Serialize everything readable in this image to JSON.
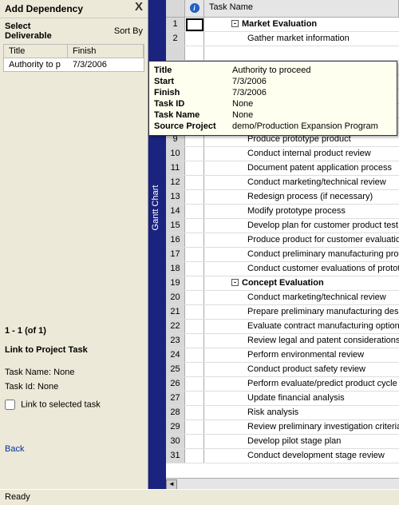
{
  "sidebar": {
    "title": "Add Dependency",
    "close_label": "X",
    "select_label": "Select Deliverable",
    "sortby_label": "Sort By",
    "col_title": "Title",
    "col_finish": "Finish",
    "row_title": "Authority to p",
    "row_finish": "7/3/2006",
    "pager": "1 - 1 (of 1)",
    "link_title": "Link to Project Task",
    "taskname_label": "Task Name:",
    "taskname_value": "None",
    "taskid_label": "Task Id:",
    "taskid_value": "None",
    "link_chk_label": "Link to selected task",
    "back_label": "Back"
  },
  "tooltip": {
    "title_label": "Title",
    "title_value": "Authority to proceed",
    "start_label": "Start",
    "start_value": "7/3/2006",
    "finish_label": "Finish",
    "finish_value": "7/3/2006",
    "taskid_label": "Task ID",
    "taskid_value": "None",
    "taskname_label": "Task Name",
    "taskname_value": "None",
    "source_label": "Source Project",
    "source_value": "demo/Production Expansion Program"
  },
  "grid": {
    "gantt_label": "Gantt Chart",
    "info_icon": "i",
    "taskname_header": "Task Name",
    "toggle_glyph": "-",
    "left_arrow": "◄"
  },
  "tasks": [
    {
      "num": "1",
      "name": "Market Evaluation",
      "summary": true,
      "indent": 0
    },
    {
      "num": "2",
      "name": "Gather market information",
      "summary": false,
      "indent": 1
    },
    {
      "num": "",
      "name": "",
      "summary": false,
      "indent": 1
    },
    {
      "num": "",
      "name": "",
      "summary": false,
      "indent": 1
    },
    {
      "num": "",
      "name": "",
      "summary": false,
      "indent": 1
    },
    {
      "num": "",
      "name": "",
      "summary": false,
      "indent": 1
    },
    {
      "num": "",
      "name": "",
      "summary": false,
      "indent": 1
    },
    {
      "num": "",
      "name": "",
      "summary": false,
      "indent": 1
    },
    {
      "num": "9",
      "name": "Produce prototype product",
      "summary": false,
      "indent": 1
    },
    {
      "num": "10",
      "name": "Conduct internal product review",
      "summary": false,
      "indent": 1
    },
    {
      "num": "11",
      "name": "Document patent application process",
      "summary": false,
      "indent": 1
    },
    {
      "num": "12",
      "name": "Conduct marketing/technical review",
      "summary": false,
      "indent": 1
    },
    {
      "num": "13",
      "name": "Redesign process (if necessary)",
      "summary": false,
      "indent": 1
    },
    {
      "num": "14",
      "name": "Modify prototype process",
      "summary": false,
      "indent": 1
    },
    {
      "num": "15",
      "name": "Develop plan for customer product test",
      "summary": false,
      "indent": 1
    },
    {
      "num": "16",
      "name": "Produce product for customer evaluation",
      "summary": false,
      "indent": 1
    },
    {
      "num": "17",
      "name": "Conduct preliminary manufacturing process",
      "summary": false,
      "indent": 1
    },
    {
      "num": "18",
      "name": "Conduct customer evaluations of prototype",
      "summary": false,
      "indent": 1
    },
    {
      "num": "19",
      "name": "Concept Evaluation",
      "summary": true,
      "indent": 0
    },
    {
      "num": "20",
      "name": "Conduct marketing/technical review",
      "summary": false,
      "indent": 1
    },
    {
      "num": "21",
      "name": "Prepare preliminary manufacturing design",
      "summary": false,
      "indent": 1
    },
    {
      "num": "22",
      "name": "Evaluate contract manufacturing option",
      "summary": false,
      "indent": 1
    },
    {
      "num": "23",
      "name": "Review legal and patent considerations",
      "summary": false,
      "indent": 1
    },
    {
      "num": "24",
      "name": "Perform environmental review",
      "summary": false,
      "indent": 1
    },
    {
      "num": "25",
      "name": "Conduct product safety review",
      "summary": false,
      "indent": 1
    },
    {
      "num": "26",
      "name": "Perform evaluate/predict product cycle",
      "summary": false,
      "indent": 1
    },
    {
      "num": "27",
      "name": "Update financial analysis",
      "summary": false,
      "indent": 1
    },
    {
      "num": "28",
      "name": "Risk analysis",
      "summary": false,
      "indent": 1
    },
    {
      "num": "29",
      "name": "Review preliminary investigation criteria",
      "summary": false,
      "indent": 1
    },
    {
      "num": "30",
      "name": "Develop pilot stage plan",
      "summary": false,
      "indent": 1
    },
    {
      "num": "31",
      "name": "Conduct development stage review",
      "summary": false,
      "indent": 1
    }
  ],
  "status": {
    "text": "Ready"
  }
}
